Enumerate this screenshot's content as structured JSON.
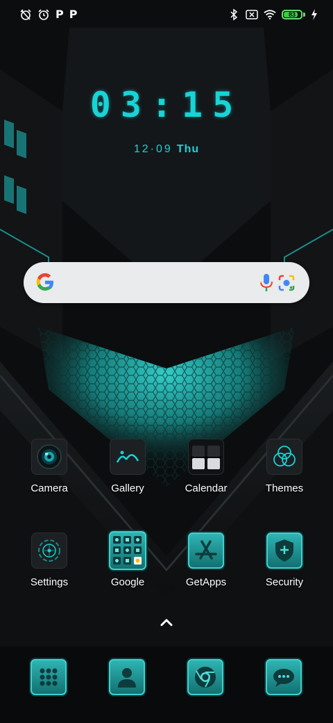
{
  "status_bar": {
    "left_icons": [
      "alarm-off-icon",
      "alarm-clock-icon",
      "parking-p-icon",
      "parking-p-icon"
    ],
    "p1": "P",
    "p2": "P",
    "right_icons": [
      "bluetooth-icon",
      "no-sim-icon",
      "wifi-icon",
      "battery-icon",
      "charging-bolt-icon"
    ],
    "battery": "83",
    "battery_level_percent": 83
  },
  "clock": {
    "time": "03:15",
    "date": "12·09",
    "day": "Thu"
  },
  "search": {
    "icons": [
      "google-g-icon",
      "mic-icon",
      "lens-icon"
    ]
  },
  "apps": [
    {
      "label": "Camera"
    },
    {
      "label": "Gallery"
    },
    {
      "label": "Calendar"
    },
    {
      "label": "Themes"
    },
    {
      "label": "Settings"
    },
    {
      "label": "Google"
    },
    {
      "label": "GetApps"
    },
    {
      "label": "Security"
    }
  ],
  "dock": {
    "icons": [
      "dialer-icon",
      "contacts-icon",
      "chrome-icon",
      "messages-icon"
    ]
  },
  "colors": {
    "accent": "#19d3d6",
    "battery": "#43c54e",
    "background": "#0b0d0e"
  }
}
